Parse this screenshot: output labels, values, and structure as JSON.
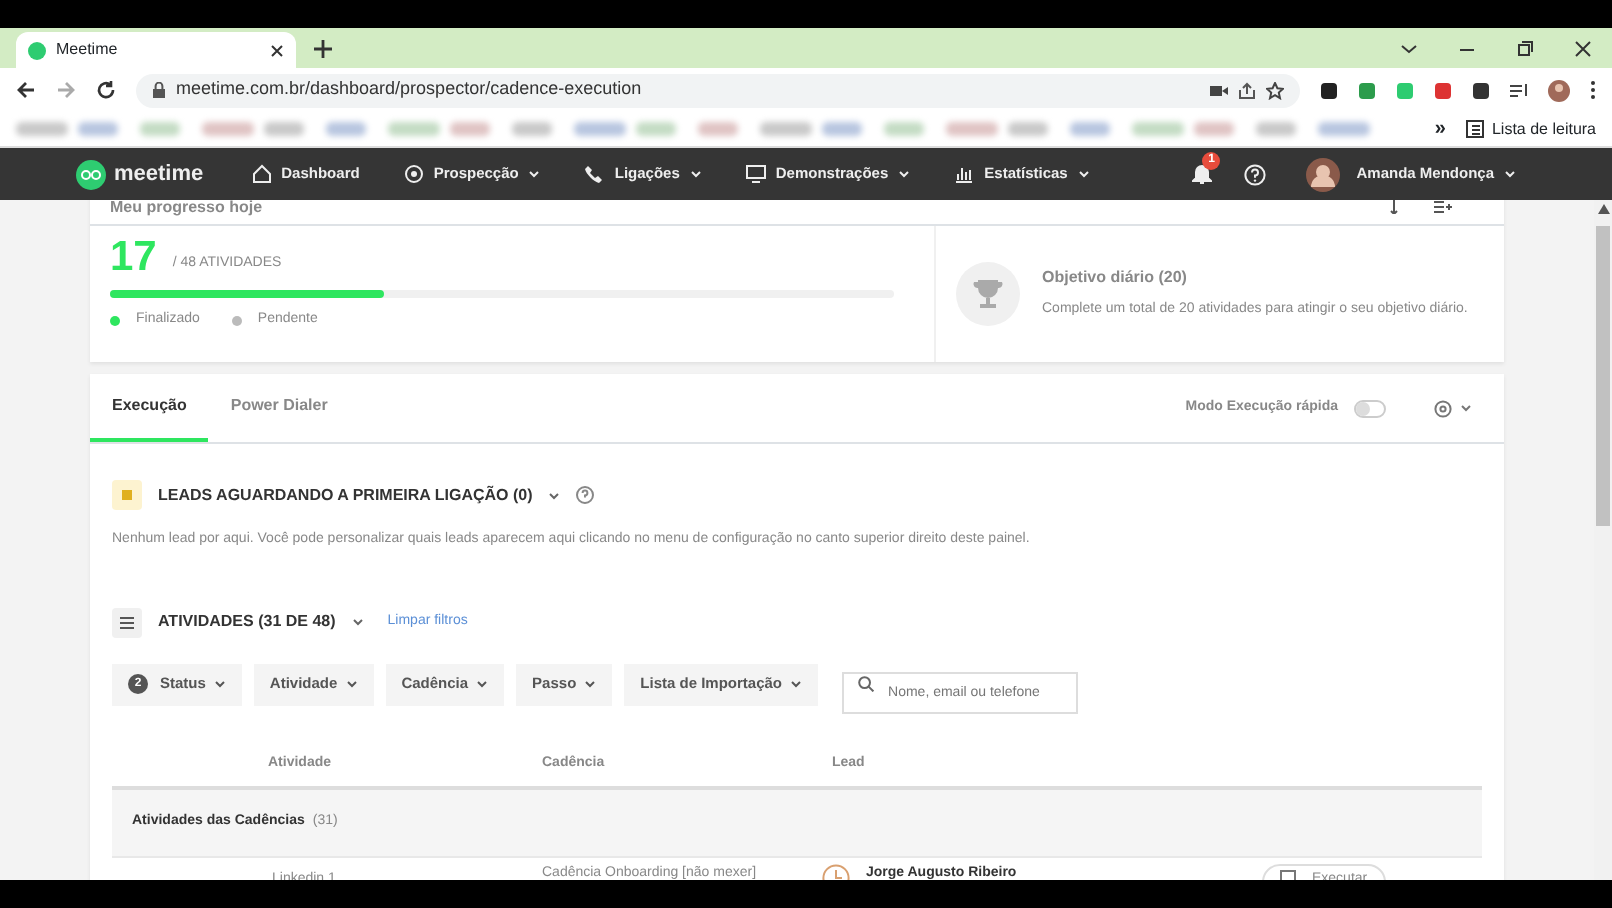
{
  "browser": {
    "tab_title": "Meetime",
    "url": "meetime.com.br/dashboard/prospector/cadence-execution",
    "reading_list": "Lista de leitura",
    "overflow": "»"
  },
  "navbar": {
    "logo": "meetime",
    "items": [
      {
        "label": "Dashboard",
        "caret": false
      },
      {
        "label": "Prospecção",
        "caret": true
      },
      {
        "label": "Ligações",
        "caret": true
      },
      {
        "label": "Demonstrações",
        "caret": true
      },
      {
        "label": "Estatísticas",
        "caret": true
      }
    ],
    "notifications": "1",
    "user": "Amanda Mendonça"
  },
  "progress": {
    "title": "Meu progresso hoje",
    "count": "17",
    "total": "/ 48 ATIVIDADES",
    "level": 0.35,
    "legend": [
      {
        "label": "Finalizado",
        "color": "#2ee65f"
      },
      {
        "label": "Pendente",
        "color": "#bbbbbb"
      }
    ],
    "goal_title": "Objetivo diário (20)",
    "goal_text": "Complete um total de 20 atividades para atingir o seu objetivo diário."
  },
  "tabs": [
    {
      "label": "Execução",
      "selected": true
    },
    {
      "label": "Power Dialer",
      "selected": false
    }
  ],
  "fast_mode": {
    "label": "Modo Execução rápida",
    "on": false
  },
  "leads": {
    "title": "LEADS AGUARDANDO A PRIMEIRA LIGAÇÃO (0)",
    "text": "Nenhum lead por aqui. Você pode personalizar quais leads aparecem aqui clicando no menu de configuração no canto superior direito deste painel."
  },
  "activities": {
    "title": "ATIVIDADES (31 DE 48)",
    "clear_filters": "Limpar filtros",
    "filters": [
      {
        "label": "Status",
        "badge": "2"
      },
      {
        "label": "Atividade"
      },
      {
        "label": "Cadência"
      },
      {
        "label": "Passo"
      },
      {
        "label": "Lista de Importação"
      }
    ],
    "search": {
      "placeholder": "Nome, email ou telefone"
    }
  },
  "table": {
    "columns": [
      "Atividade",
      "Cadência",
      "Lead"
    ],
    "group": {
      "label": "Atividades das Cadências",
      "count": "(31)"
    },
    "rows": [
      {
        "activity": "Linkedin 1",
        "cadence": "Cadência Onboarding [não mexer]",
        "lead": "Jorge Augusto Ribeiro",
        "action": "Executar"
      }
    ]
  }
}
